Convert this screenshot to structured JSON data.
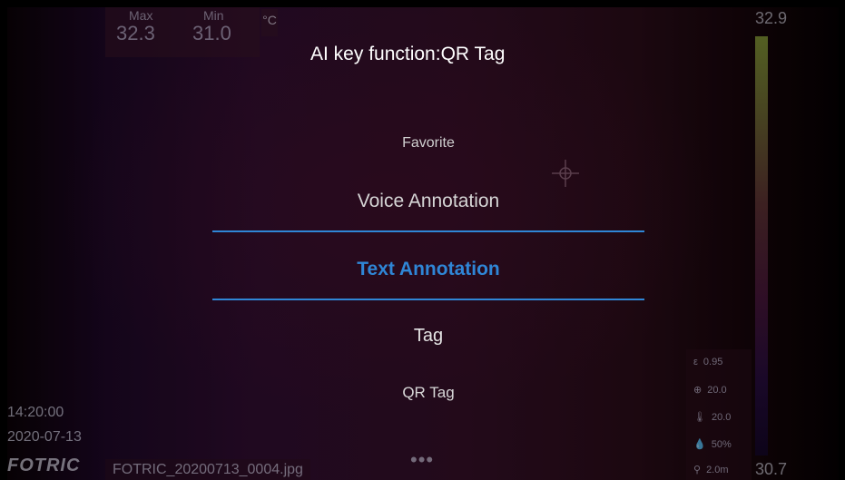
{
  "overlay": {
    "max_label": "Max",
    "min_label": "Min",
    "max_value": "32.3",
    "min_value": "31.0",
    "unit": "°C",
    "scale_high": "32.9",
    "scale_low": "30.7",
    "time": "14:20:00",
    "date": "2020-07-13",
    "logo": "FOTRIC",
    "filename": "FOTRIC_20200713_0004.jpg",
    "more_icon": "•••",
    "params": [
      {
        "icon": "ε",
        "value": "0.95"
      },
      {
        "icon": "⊕",
        "value": "20.0"
      },
      {
        "icon": "🌡",
        "value": "20.0"
      },
      {
        "icon": "💧",
        "value": "50%"
      },
      {
        "icon": "⚲",
        "value": "2.0m"
      }
    ]
  },
  "dialog": {
    "title": "AI key function:QR Tag",
    "items": [
      "Favorite",
      "Voice Annotation",
      "Text Annotation",
      "Tag",
      "QR Tag"
    ],
    "selected": "Text Annotation",
    "accent_color": "#2f86d6"
  }
}
